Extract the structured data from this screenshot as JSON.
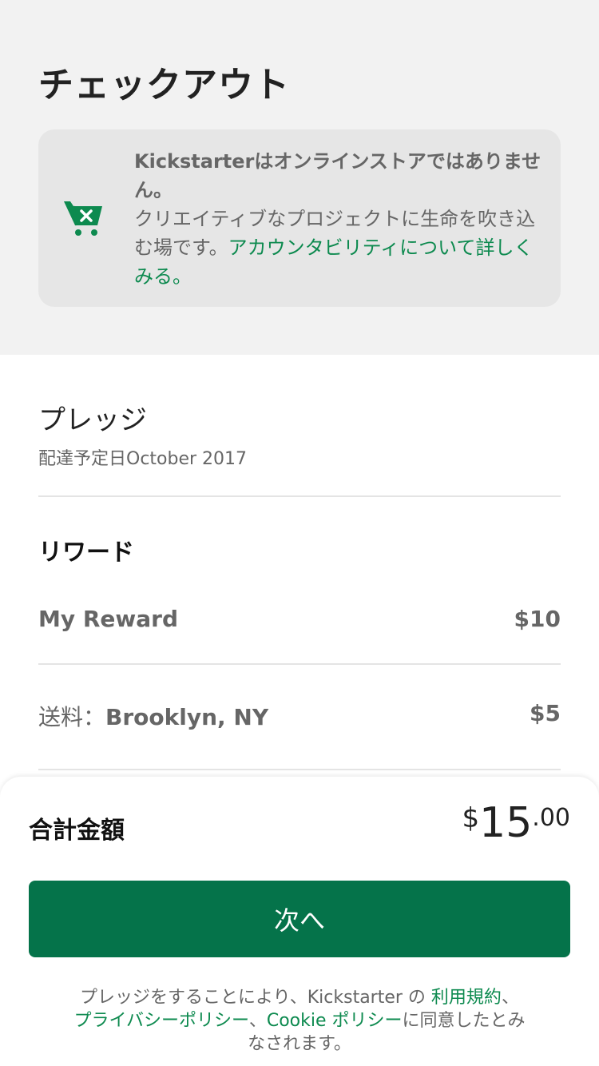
{
  "header": {
    "title": "チェックアウト"
  },
  "notice": {
    "headline": "Kickstarterはオンラインストアではありません。",
    "body": "クリエイティブなプロジェクトに生命を吹き込む場です。",
    "link": "アカウンタビリティについて詳しくみる。",
    "icon": "cart-x-icon",
    "accent_color": "#0d8a4f"
  },
  "pledge": {
    "heading": "プレッジ",
    "delivery": "配達予定日October 2017"
  },
  "rewards": {
    "heading": "リワード",
    "items": [
      {
        "name": "My Reward",
        "amount": "$10"
      }
    ],
    "shipping": {
      "label": "送料：",
      "location": "Brooklyn, NY",
      "amount": "$5"
    }
  },
  "total": {
    "label": "合計金額",
    "currency": "$",
    "whole": "15",
    "cents": ".00"
  },
  "cta": {
    "label": "次へ",
    "color": "#05734a"
  },
  "legal": {
    "prefix": "プレッジをすることにより、Kickstarter の ",
    "terms": "利用規約",
    "sep1": "、",
    "privacy": "プライバシーポリシー",
    "sep2": "、",
    "cookie": "Cookie ポリシー",
    "suffix": "に同意したとみなされます。"
  }
}
